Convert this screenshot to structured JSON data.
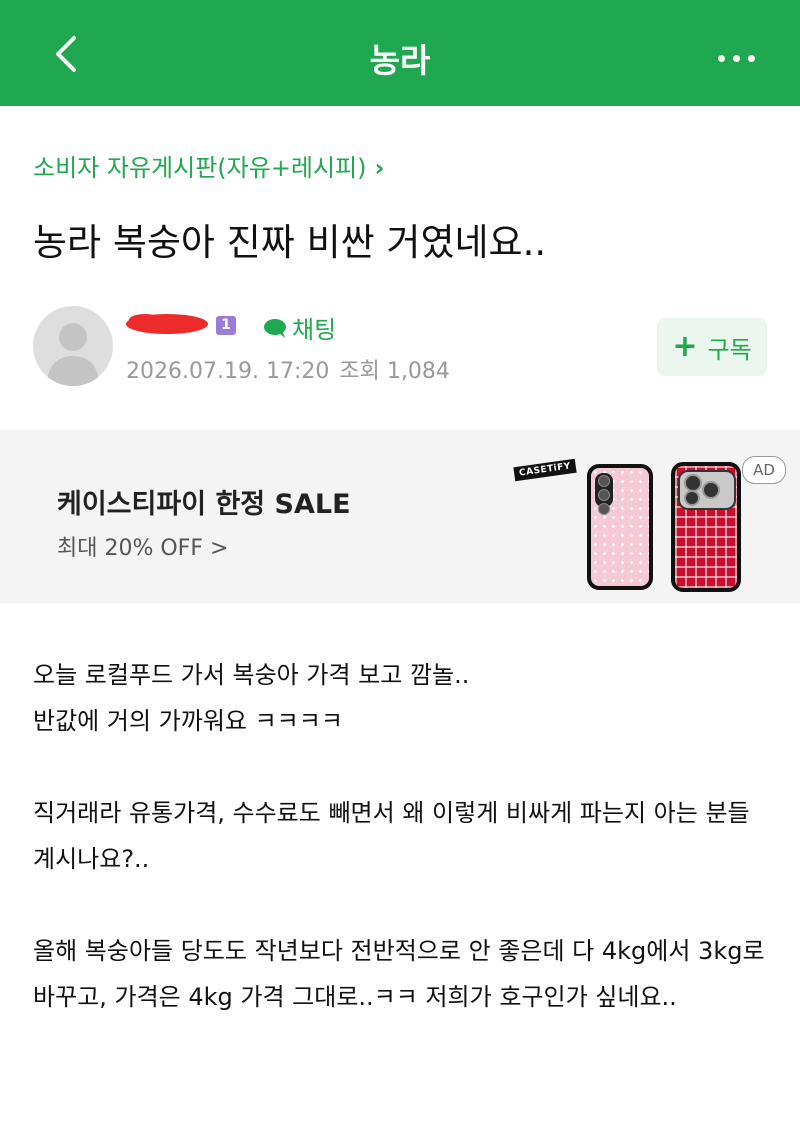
{
  "header": {
    "title": "농라",
    "back_icon": "chevron-left-icon",
    "more_icon": "more-horizontal-icon",
    "color": "#1fa84f"
  },
  "post": {
    "board": "소비자 자유게시판(자유+레시피)",
    "title": "농라 복숭아 진짜 비싼 거였네요..",
    "author": {
      "level": "1",
      "chat_label": "채팅",
      "date": "2026.07.19. 17:20",
      "views": "조회 1,084"
    },
    "subscribe_label": "구독",
    "body": [
      "오늘 로컬푸드 가서 복숭아 가격 보고 깜놀..\n반값에 거의 가까워요 ㅋㅋㅋㅋ",
      "직거래라 유통가격, 수수료도 빼면서 왜 이렇게 비싸게 파는지 아는 분들 계시나요?..",
      "올해 복숭아들 당도도 작년보다 전반적으로 안 좋은데 다 4kg에서 3kg로 바꾸고, 가격은 4kg 가격 그대로..ㅋㅋ 저희가 호구인가 싶네요.."
    ]
  },
  "ad": {
    "title": "케이스티파이 한정 SALE",
    "subtitle": "최대 20% OFF >",
    "brand": "CASETiFY",
    "badge": "AD"
  }
}
